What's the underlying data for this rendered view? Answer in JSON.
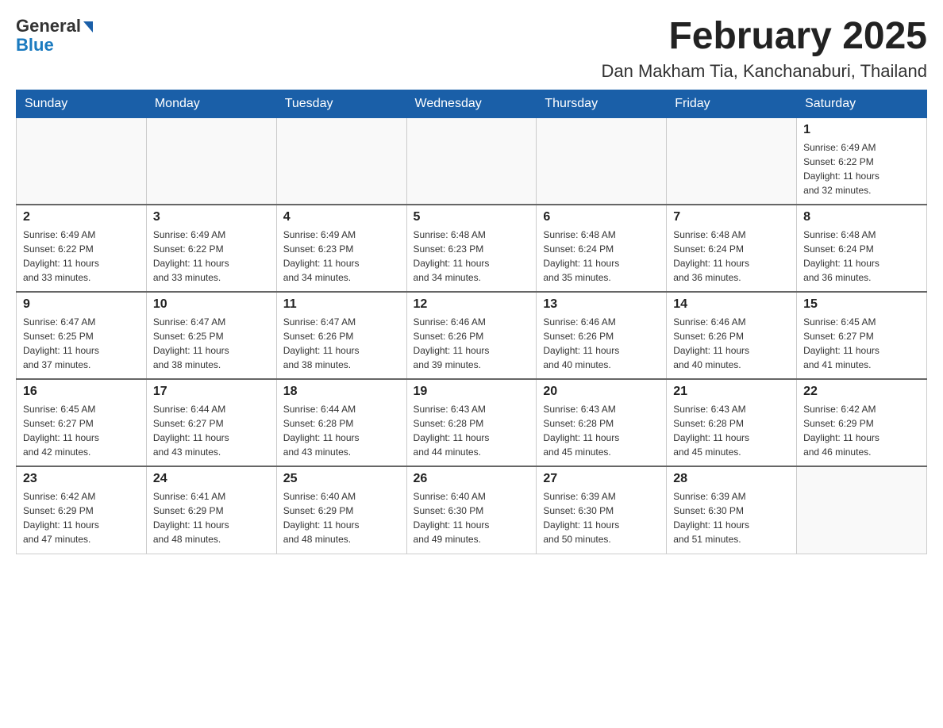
{
  "header": {
    "logo_general": "General",
    "logo_blue": "Blue",
    "month_title": "February 2025",
    "location": "Dan Makham Tia, Kanchanaburi, Thailand"
  },
  "weekdays": [
    "Sunday",
    "Monday",
    "Tuesday",
    "Wednesday",
    "Thursday",
    "Friday",
    "Saturday"
  ],
  "weeks": [
    [
      {
        "day": "",
        "info": ""
      },
      {
        "day": "",
        "info": ""
      },
      {
        "day": "",
        "info": ""
      },
      {
        "day": "",
        "info": ""
      },
      {
        "day": "",
        "info": ""
      },
      {
        "day": "",
        "info": ""
      },
      {
        "day": "1",
        "info": "Sunrise: 6:49 AM\nSunset: 6:22 PM\nDaylight: 11 hours\nand 32 minutes."
      }
    ],
    [
      {
        "day": "2",
        "info": "Sunrise: 6:49 AM\nSunset: 6:22 PM\nDaylight: 11 hours\nand 33 minutes."
      },
      {
        "day": "3",
        "info": "Sunrise: 6:49 AM\nSunset: 6:22 PM\nDaylight: 11 hours\nand 33 minutes."
      },
      {
        "day": "4",
        "info": "Sunrise: 6:49 AM\nSunset: 6:23 PM\nDaylight: 11 hours\nand 34 minutes."
      },
      {
        "day": "5",
        "info": "Sunrise: 6:48 AM\nSunset: 6:23 PM\nDaylight: 11 hours\nand 34 minutes."
      },
      {
        "day": "6",
        "info": "Sunrise: 6:48 AM\nSunset: 6:24 PM\nDaylight: 11 hours\nand 35 minutes."
      },
      {
        "day": "7",
        "info": "Sunrise: 6:48 AM\nSunset: 6:24 PM\nDaylight: 11 hours\nand 36 minutes."
      },
      {
        "day": "8",
        "info": "Sunrise: 6:48 AM\nSunset: 6:24 PM\nDaylight: 11 hours\nand 36 minutes."
      }
    ],
    [
      {
        "day": "9",
        "info": "Sunrise: 6:47 AM\nSunset: 6:25 PM\nDaylight: 11 hours\nand 37 minutes."
      },
      {
        "day": "10",
        "info": "Sunrise: 6:47 AM\nSunset: 6:25 PM\nDaylight: 11 hours\nand 38 minutes."
      },
      {
        "day": "11",
        "info": "Sunrise: 6:47 AM\nSunset: 6:26 PM\nDaylight: 11 hours\nand 38 minutes."
      },
      {
        "day": "12",
        "info": "Sunrise: 6:46 AM\nSunset: 6:26 PM\nDaylight: 11 hours\nand 39 minutes."
      },
      {
        "day": "13",
        "info": "Sunrise: 6:46 AM\nSunset: 6:26 PM\nDaylight: 11 hours\nand 40 minutes."
      },
      {
        "day": "14",
        "info": "Sunrise: 6:46 AM\nSunset: 6:26 PM\nDaylight: 11 hours\nand 40 minutes."
      },
      {
        "day": "15",
        "info": "Sunrise: 6:45 AM\nSunset: 6:27 PM\nDaylight: 11 hours\nand 41 minutes."
      }
    ],
    [
      {
        "day": "16",
        "info": "Sunrise: 6:45 AM\nSunset: 6:27 PM\nDaylight: 11 hours\nand 42 minutes."
      },
      {
        "day": "17",
        "info": "Sunrise: 6:44 AM\nSunset: 6:27 PM\nDaylight: 11 hours\nand 43 minutes."
      },
      {
        "day": "18",
        "info": "Sunrise: 6:44 AM\nSunset: 6:28 PM\nDaylight: 11 hours\nand 43 minutes."
      },
      {
        "day": "19",
        "info": "Sunrise: 6:43 AM\nSunset: 6:28 PM\nDaylight: 11 hours\nand 44 minutes."
      },
      {
        "day": "20",
        "info": "Sunrise: 6:43 AM\nSunset: 6:28 PM\nDaylight: 11 hours\nand 45 minutes."
      },
      {
        "day": "21",
        "info": "Sunrise: 6:43 AM\nSunset: 6:28 PM\nDaylight: 11 hours\nand 45 minutes."
      },
      {
        "day": "22",
        "info": "Sunrise: 6:42 AM\nSunset: 6:29 PM\nDaylight: 11 hours\nand 46 minutes."
      }
    ],
    [
      {
        "day": "23",
        "info": "Sunrise: 6:42 AM\nSunset: 6:29 PM\nDaylight: 11 hours\nand 47 minutes."
      },
      {
        "day": "24",
        "info": "Sunrise: 6:41 AM\nSunset: 6:29 PM\nDaylight: 11 hours\nand 48 minutes."
      },
      {
        "day": "25",
        "info": "Sunrise: 6:40 AM\nSunset: 6:29 PM\nDaylight: 11 hours\nand 48 minutes."
      },
      {
        "day": "26",
        "info": "Sunrise: 6:40 AM\nSunset: 6:30 PM\nDaylight: 11 hours\nand 49 minutes."
      },
      {
        "day": "27",
        "info": "Sunrise: 6:39 AM\nSunset: 6:30 PM\nDaylight: 11 hours\nand 50 minutes."
      },
      {
        "day": "28",
        "info": "Sunrise: 6:39 AM\nSunset: 6:30 PM\nDaylight: 11 hours\nand 51 minutes."
      },
      {
        "day": "",
        "info": ""
      }
    ]
  ]
}
